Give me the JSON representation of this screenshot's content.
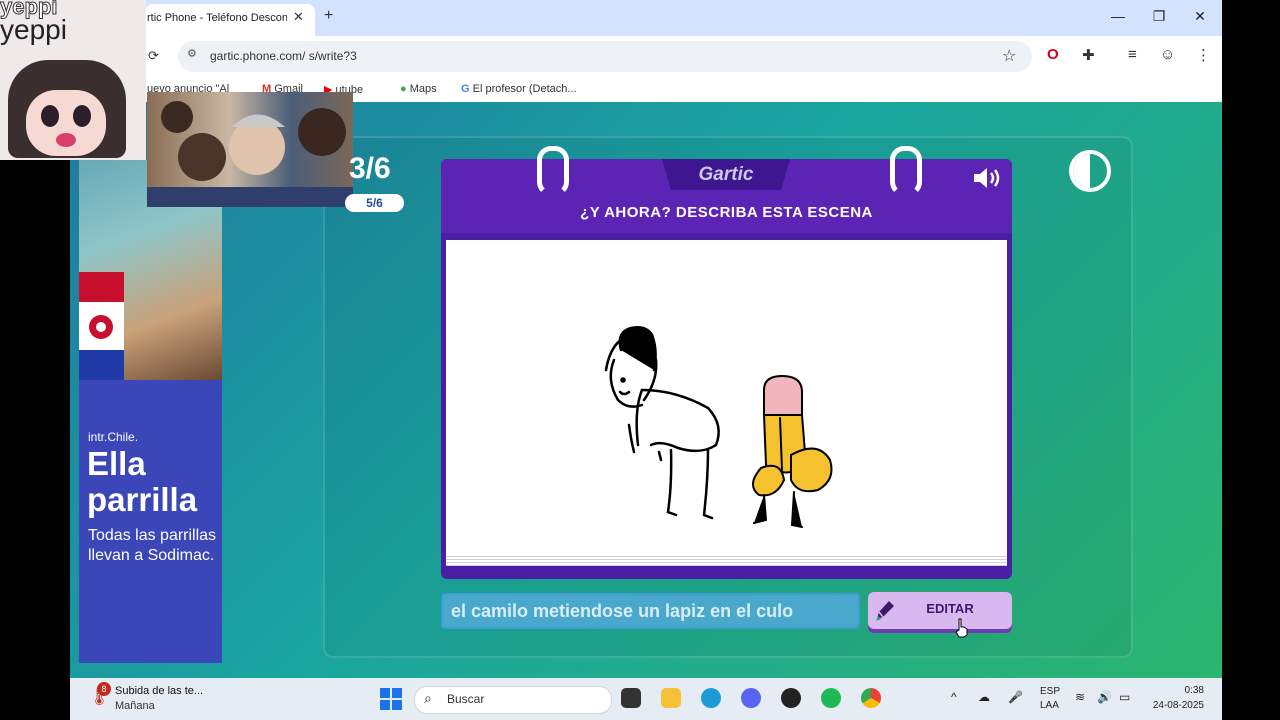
{
  "browser": {
    "tab_title": "rtic Phone - Teléfono Descon",
    "tab_close": "✕",
    "new_tab": "+",
    "url": "gartic.phone.com/  s/write?3",
    "win_minimize": "—",
    "win_restore": "❐",
    "win_close": "✕",
    "bookmarks": [
      "uevo anuncio \"Al",
      "Gmail",
      "utube",
      "Maps",
      "El profesor (Detach..."
    ]
  },
  "overlays": {
    "yeppi_top": "yeppi",
    "yeppi_bottom": "yeppi"
  },
  "ad": {
    "brand": "intr.Chile.",
    "title": "Ella parrilla",
    "body": "Todas las parrillas llevan a Sodimac."
  },
  "game": {
    "round_big": "3/6",
    "round_small": "5/6",
    "logo": "Gartic",
    "prompt": "¿Y AHORA? DESCRIBA ESTA ESCENA",
    "answer_value": "el camilo metiendose un lapiz en el culo",
    "edit_label": "EDITAR",
    "colors": {
      "card": "#4b1fa3",
      "header": "#5b24b4",
      "edit_button": "#d8b8ee",
      "answer_bg": "#4aa8cc"
    }
  },
  "taskbar": {
    "notification_count": "8",
    "notification_title": "Subida de las te...",
    "notification_sub": "Mañana",
    "search_label": "Buscar",
    "lang_top": "ESP",
    "lang_bottom": "LAA",
    "time": "0:38",
    "date": "24-08-2025"
  }
}
